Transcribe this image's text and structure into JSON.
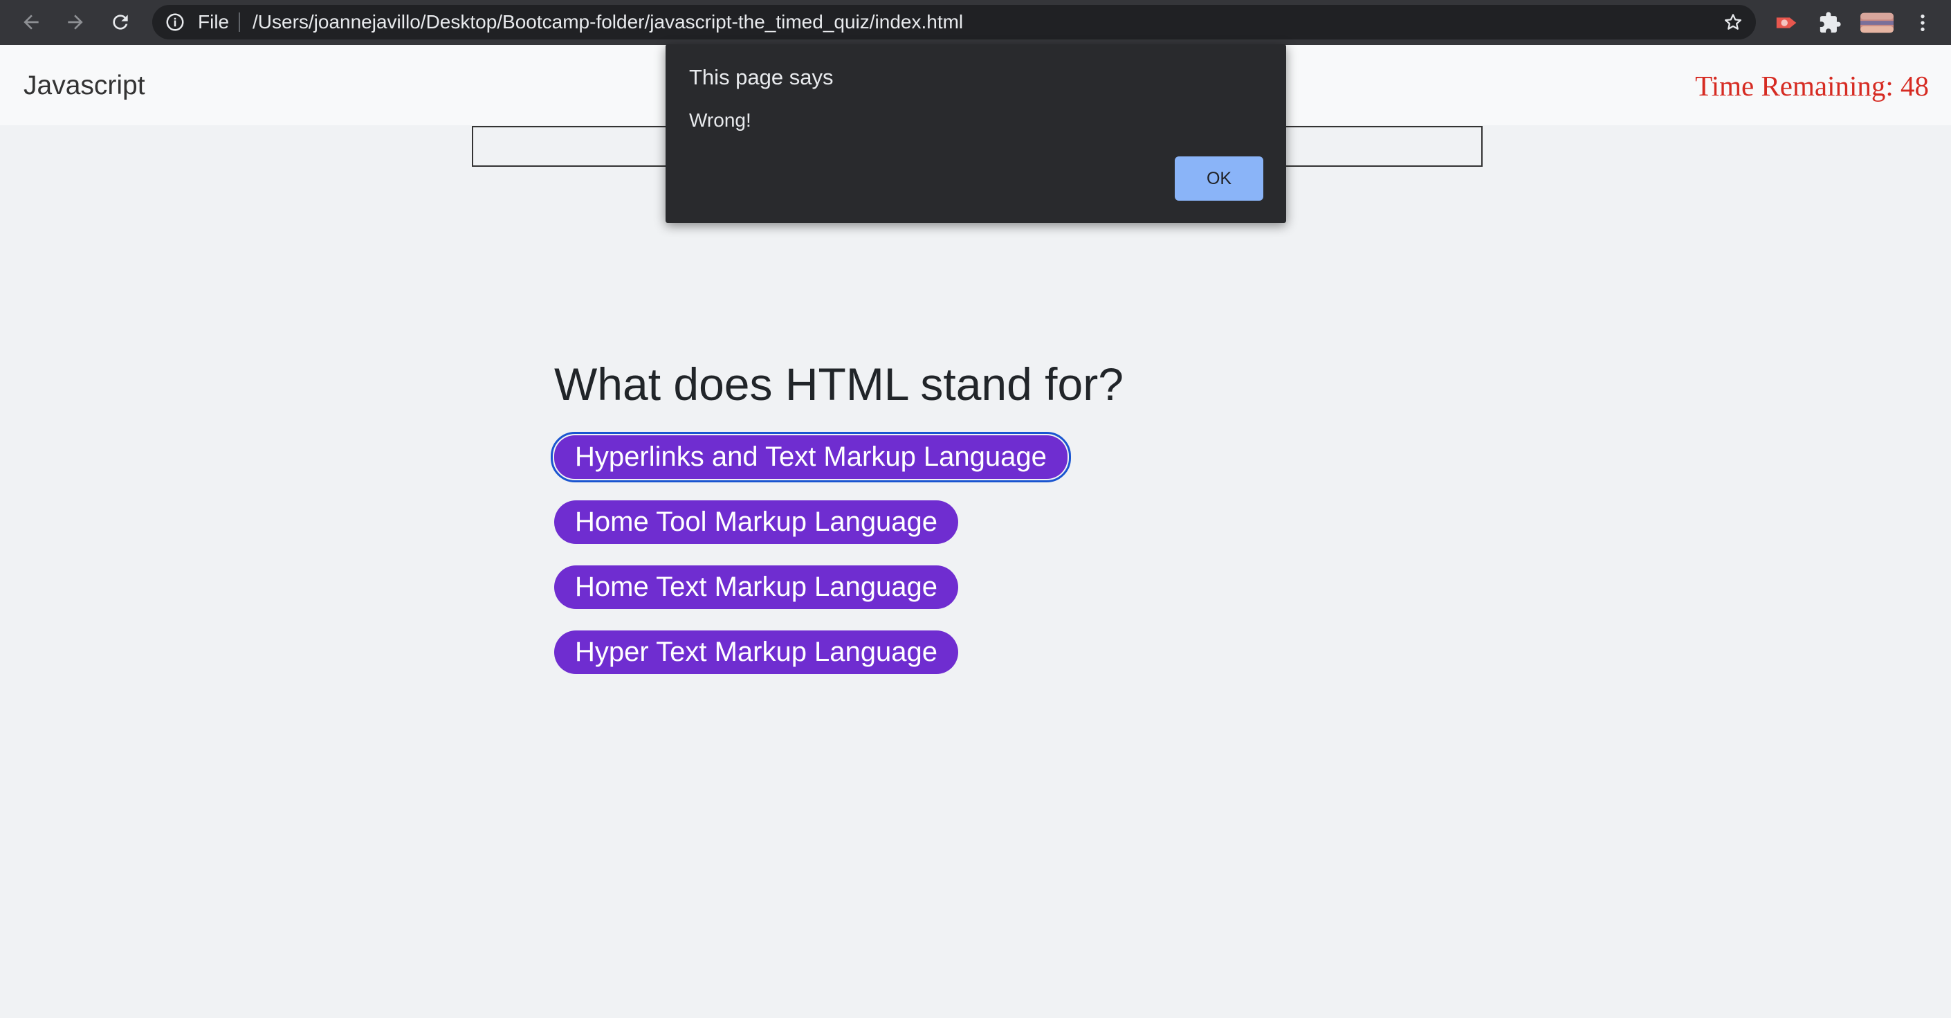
{
  "browser": {
    "back_icon": "arrow-left-icon",
    "forward_icon": "arrow-right-icon",
    "reload_icon": "reload-icon",
    "omnibox": {
      "scheme_label": "File",
      "url": "/Users/joannejavillo/Desktop/Bootcamp-folder/javascript-the_timed_quiz/index.html"
    },
    "extensions": [
      "record-extension-icon",
      "puzzle-extensions-icon",
      "profile-avatar-icon",
      "menu-kebab-icon"
    ]
  },
  "navbar": {
    "brand": "Javascript",
    "timer": "Time Remaining: 48",
    "timer_color": "#d62b22"
  },
  "quiz": {
    "question": "What does HTML stand for?",
    "answers": [
      "Hyperlinks and Text Markup Language",
      "Home Tool Markup Language",
      "Home Text Markup Language",
      "Hyper Text Markup Language"
    ],
    "answer_color": "#6f2dd0",
    "focused_answer_index": 0
  },
  "dialog": {
    "title": "This page says",
    "message": "Wrong!",
    "ok_label": "OK",
    "ok_color": "#8ab4f8"
  }
}
